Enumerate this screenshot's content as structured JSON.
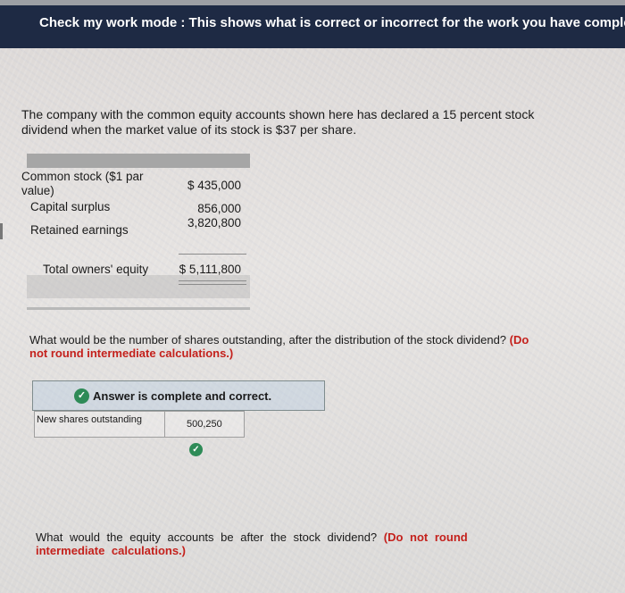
{
  "banner": {
    "text": "Check my work mode : This shows what is correct or incorrect for the work you have complet"
  },
  "intro": {
    "text": "The company with the common equity accounts shown here has declared a 15 percent stock dividend when the market value of its stock is $37 per share."
  },
  "equity_table": {
    "rows": [
      {
        "label": "Common stock ($1 par value)",
        "value": "$ 435,000"
      },
      {
        "label": "Capital surplus",
        "value": "856,000"
      },
      {
        "label": "Retained earnings",
        "value": "3,820,800"
      }
    ],
    "total": {
      "label": "Total owners' equity",
      "value": "$ 5,111,800"
    }
  },
  "question1": {
    "text": "What would be the number of shares outstanding, after the distribution of the stock dividend?",
    "note": "(Do not round intermediate calculations.)"
  },
  "answer": {
    "status": "Answer is complete and correct.",
    "label": "New shares outstanding",
    "value": "500,250"
  },
  "question2": {
    "text": "What would the equity accounts be after the stock dividend?",
    "note": "(Do not round intermediate calculations.)"
  },
  "colors": {
    "banner_bg": "#1e2a44",
    "correct_green": "#2e8b57",
    "note_red": "#c4211c"
  },
  "icons": {
    "correct": "check-circle-icon"
  }
}
